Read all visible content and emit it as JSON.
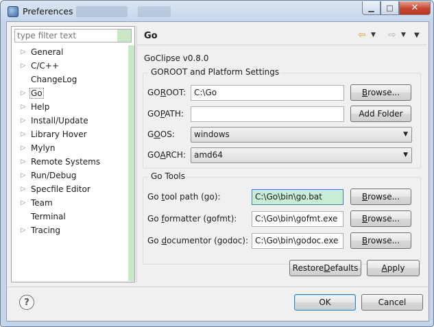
{
  "window": {
    "title": "Preferences",
    "minimize_icon": "minimize-icon",
    "maximize_icon": "maximize-icon",
    "close_icon": "close-icon"
  },
  "filter": {
    "placeholder": "type filter text",
    "value": ""
  },
  "tree": {
    "items": [
      {
        "label": "General",
        "expandable": true
      },
      {
        "label": "C/C++",
        "expandable": true
      },
      {
        "label": "ChangeLog",
        "expandable": false
      },
      {
        "label": "Go",
        "expandable": true,
        "selected": true
      },
      {
        "label": "Help",
        "expandable": true
      },
      {
        "label": "Install/Update",
        "expandable": true
      },
      {
        "label": "Library Hover",
        "expandable": true
      },
      {
        "label": "Mylyn",
        "expandable": true
      },
      {
        "label": "Remote Systems",
        "expandable": true
      },
      {
        "label": "Run/Debug",
        "expandable": true
      },
      {
        "label": "Specfile Editor",
        "expandable": true
      },
      {
        "label": "Team",
        "expandable": true
      },
      {
        "label": "Terminal",
        "expandable": false
      },
      {
        "label": "Tracing",
        "expandable": true
      }
    ]
  },
  "page": {
    "title": "Go",
    "version": "GoClipse v0.8.0",
    "nav": {
      "back_icon": "back-arrow-icon",
      "forward_icon": "forward-arrow-icon",
      "menu_icon": "view-menu-icon"
    }
  },
  "goroot_group": {
    "title": "GOROOT and Platform Settings",
    "goroot": {
      "label_pre": "GO",
      "label_mnemonic": "R",
      "label_post": "OOT:",
      "value": "C:\\Go",
      "button_pre": "",
      "button_mnemonic": "B",
      "button_post": "rowse..."
    },
    "gopath": {
      "label_pre": "GO",
      "label_mnemonic": "P",
      "label_post": "ATH:",
      "value": "",
      "button": "Add Folder"
    },
    "goos": {
      "label_pre": "G",
      "label_mnemonic": "O",
      "label_post": "OS:",
      "value": "windows"
    },
    "goarch": {
      "label_pre": "GO",
      "label_mnemonic": "A",
      "label_post": "RCH:",
      "value": "amd64"
    }
  },
  "tools_group": {
    "title": "Go Tools",
    "go_tool": {
      "label_pre": "Go ",
      "label_mnemonic": "t",
      "label_post": "ool path (go):",
      "value": "C:\\Go\\bin\\go.bat"
    },
    "gofmt": {
      "label_pre": "Go ",
      "label_mnemonic": "f",
      "label_post": "ormatter (gofmt):",
      "value": "C:\\Go\\bin\\gofmt.exe"
    },
    "godoc": {
      "label_pre": "Go ",
      "label_mnemonic": "d",
      "label_post": "ocumentor (godoc):",
      "value": "C:\\Go\\bin\\godoc.exe"
    },
    "browse_pre": "",
    "browse_mnemonic": "B",
    "browse_post": "rowse..."
  },
  "page_buttons": {
    "restore_pre": "Restore ",
    "restore_mnemonic": "D",
    "restore_post": "efaults",
    "apply_pre": "",
    "apply_mnemonic": "A",
    "apply_post": "pply"
  },
  "dialog_buttons": {
    "ok": "OK",
    "cancel": "Cancel",
    "help_icon": "help-icon"
  },
  "colors": {
    "accent_focus": "#3c7fb1",
    "highlight_green": "#c8e8c8",
    "close_red": "#c8452f"
  }
}
